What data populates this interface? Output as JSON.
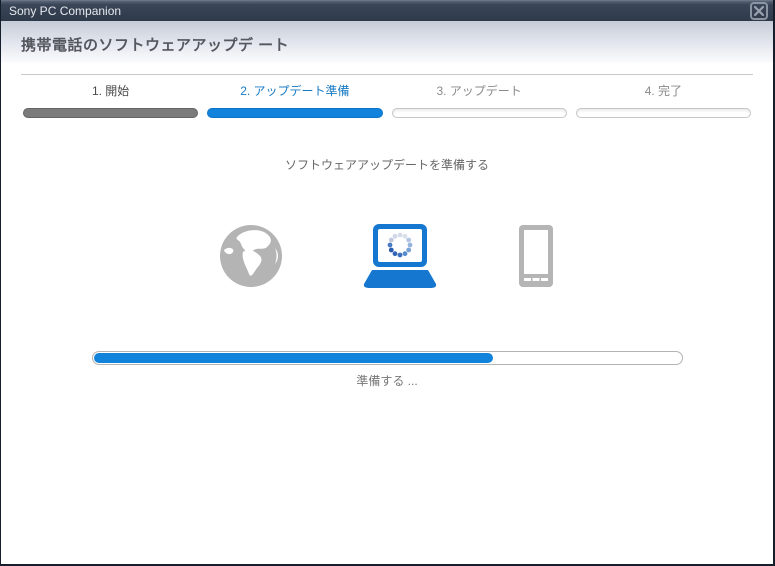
{
  "window": {
    "title": "Sony PC Companion"
  },
  "header": {
    "title": "携帯電話のソフトウェアアップデ ート"
  },
  "wizard": {
    "steps": [
      {
        "label": "1. 開始",
        "state": "done",
        "progress": 100
      },
      {
        "label": "2. アップデート準備",
        "state": "active",
        "progress": 100
      },
      {
        "label": "3. アップデート",
        "state": "pending",
        "progress": 0
      },
      {
        "label": "4. 完了",
        "state": "pending",
        "progress": 0
      }
    ],
    "subtitle": "ソフトウェアアップデートを準備する",
    "progress_percent": 68,
    "status_text": "準備する ..."
  },
  "icons": {
    "source": "globe-icon",
    "computer": "laptop-with-loading-spinner-icon",
    "device": "phone-icon"
  },
  "colors": {
    "accent_blue": "#1283dc",
    "active_step_text": "#1a7bc4",
    "titlebar_navy": "#323e52",
    "done_step_gray": "#7b7b7b",
    "icon_gray": "#b5b5b5",
    "laptop_blue": "#1577d0"
  }
}
